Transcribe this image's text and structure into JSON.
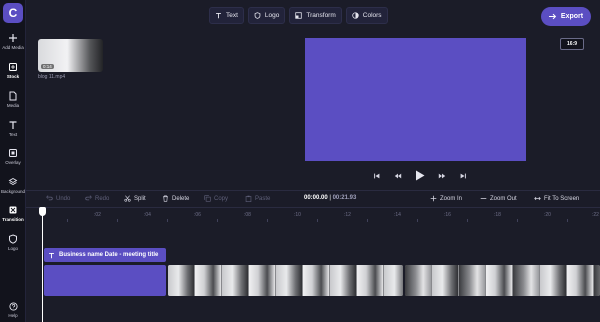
{
  "sidebar": {
    "items": [
      {
        "label": "Add Media",
        "icon": "plus-icon"
      },
      {
        "label": "Stock",
        "icon": "stock-icon"
      },
      {
        "label": "Media",
        "icon": "file-icon"
      },
      {
        "label": "Text",
        "icon": "text-icon"
      },
      {
        "label": "Overlay",
        "icon": "overlay-icon"
      },
      {
        "label": "Background",
        "icon": "layers-icon"
      },
      {
        "label": "Transition",
        "icon": "transition-icon"
      },
      {
        "label": "Logo",
        "icon": "shield-icon"
      }
    ],
    "help": "Help",
    "logo_letter": "C"
  },
  "toolbar": {
    "text": "Text",
    "logo": "Logo",
    "transform": "Transform",
    "colors": "Colors",
    "export": "Export"
  },
  "aspect_ratio": "16:9",
  "media": {
    "file_name": "blog 11.mp4",
    "duration": "0:14"
  },
  "timeline": {
    "undo": "Undo",
    "redo": "Redo",
    "split": "Split",
    "delete": "Delete",
    "copy": "Copy",
    "paste": "Paste",
    "current_time": "00:00.00",
    "separator": " | ",
    "total_time": "00:21.93",
    "zoom_in": "Zoom In",
    "zoom_out": "Zoom Out",
    "fit_to_screen": "Fit To Screen",
    "ticks": [
      "0",
      ":02",
      ":04",
      ":06",
      ":08",
      ":10",
      ":12",
      ":14",
      ":16",
      ":18",
      ":20",
      ":22"
    ],
    "text_clip_title": "Business name Date - meeting title"
  },
  "colors": {
    "accent": "#5b4ec2",
    "background": "#1b1c28"
  }
}
